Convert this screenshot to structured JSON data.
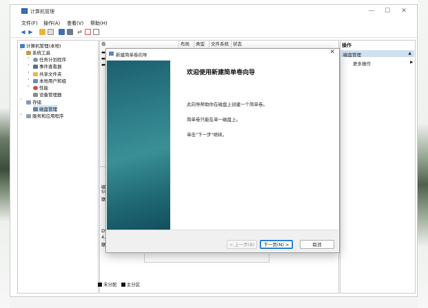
{
  "window": {
    "title": "计算机管理",
    "controls": {
      "minimize": "—",
      "maximize": "☐",
      "close": "✕"
    }
  },
  "menu": [
    "文件(F)",
    "操作(A)",
    "查看(V)",
    "帮助(H)"
  ],
  "toolbar_icons": [
    "back-icon",
    "forward-icon",
    "folder-up-icon",
    "help-icon",
    "properties-icon",
    "console-icon",
    "connect-icon",
    "check-icon",
    "panel-icon"
  ],
  "tree": {
    "root": "计算机管理(本地)",
    "system_tools": "系统工具",
    "task_scheduler": "任务计划程序",
    "event_viewer": "事件查看器",
    "shared_folders": "共享文件夹",
    "local_users": "本地用户和组",
    "performance": "性能",
    "device_manager": "设备管理器",
    "storage": "存储",
    "disk_management": "磁盘管理",
    "services_apps": "服务和应用程序"
  },
  "columns": [
    "卷",
    "布局",
    "类型",
    "文件系统",
    "状态"
  ],
  "disk_partial": {
    "disk0": [
      "磁",
      "59",
      "联"
    ],
    "dvd": [
      "DV",
      "4.3",
      "联"
    ]
  },
  "legend": {
    "unallocated": "未分配",
    "primary": "主分区"
  },
  "actions": {
    "header": "操作",
    "selected": "磁盘管理",
    "more": "更多操作"
  },
  "dialog": {
    "title": "新建简单卷向导",
    "heading": "欢迎使用新建简单卷向导",
    "line1": "此向导帮助你在磁盘上创建一个简单卷。",
    "line2": "简单卷只能在单一磁盘上。",
    "line3": "单击\"下一步\"继续。",
    "back_button": "< 上一步(B)",
    "next_button": "下一页(N) >",
    "cancel_button": "取消",
    "close": "✕"
  },
  "colors": {
    "accent": "#0067c0",
    "wizard_band": "#2e7f8a",
    "selection": "#cfe0f1"
  }
}
